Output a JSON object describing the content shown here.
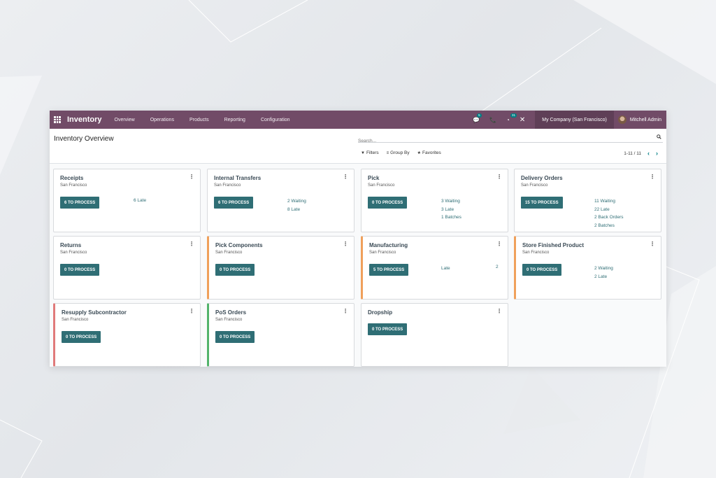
{
  "navbar": {
    "app_name": "Inventory",
    "menu": [
      "Overview",
      "Operations",
      "Products",
      "Reporting",
      "Configuration"
    ],
    "messages_badge": "5",
    "activity_badge": "31",
    "company": "My Company (San Francisco)",
    "user": "Mitchell Admin"
  },
  "control": {
    "title": "Inventory Overview",
    "search_placeholder": "Search...",
    "filters": "Filters",
    "group_by": "Group By",
    "favorites": "Favorites",
    "pager": "1-11 / 11"
  },
  "cards": [
    {
      "title": "Receipts",
      "subtitle": "San Francisco",
      "button": "6 TO PROCESS",
      "stats": [
        "6 Late"
      ]
    },
    {
      "title": "Internal Transfers",
      "subtitle": "San Francisco",
      "button": "6 TO PROCESS",
      "stats": [
        "2 Waiting",
        "8 Late"
      ]
    },
    {
      "title": "Pick",
      "subtitle": "San Francisco",
      "button": "0 TO PROCESS",
      "stats": [
        "3 Waiting",
        "3 Late",
        "1 Batches"
      ]
    },
    {
      "title": "Delivery Orders",
      "subtitle": "San Francisco",
      "button": "15 TO PROCESS",
      "stats": [
        "11 Waiting",
        "22 Late",
        "2 Back Orders",
        "2 Batches"
      ]
    },
    {
      "title": "Returns",
      "subtitle": "San Francisco",
      "button": "0 TO PROCESS",
      "stats": []
    },
    {
      "title": "Pick Components",
      "subtitle": "San Francisco",
      "button": "0 TO PROCESS",
      "stats": []
    },
    {
      "title": "Manufacturing",
      "subtitle": "San Francisco",
      "button": "5 TO PROCESS",
      "stats": [
        "Late"
      ],
      "stat_value": "2"
    },
    {
      "title": "Store Finished Product",
      "subtitle": "San Francisco",
      "button": "0 TO PROCESS",
      "stats": [
        "2 Waiting",
        "2 Late"
      ]
    },
    {
      "title": "Resupply Subcontractor",
      "subtitle": "San Francisco",
      "button": "0 TO PROCESS",
      "stats": []
    },
    {
      "title": "PoS Orders",
      "subtitle": "San Francisco",
      "button": "0 TO PROCESS",
      "stats": []
    },
    {
      "title": "Dropship",
      "subtitle": "",
      "button": "0 TO PROCESS",
      "stats": []
    }
  ],
  "colors": {
    "navbar": "#714b67",
    "button": "#2f6e75",
    "accent_orange": "#f0a05b",
    "accent_red": "#e07a7a",
    "accent_green": "#52b36b"
  }
}
